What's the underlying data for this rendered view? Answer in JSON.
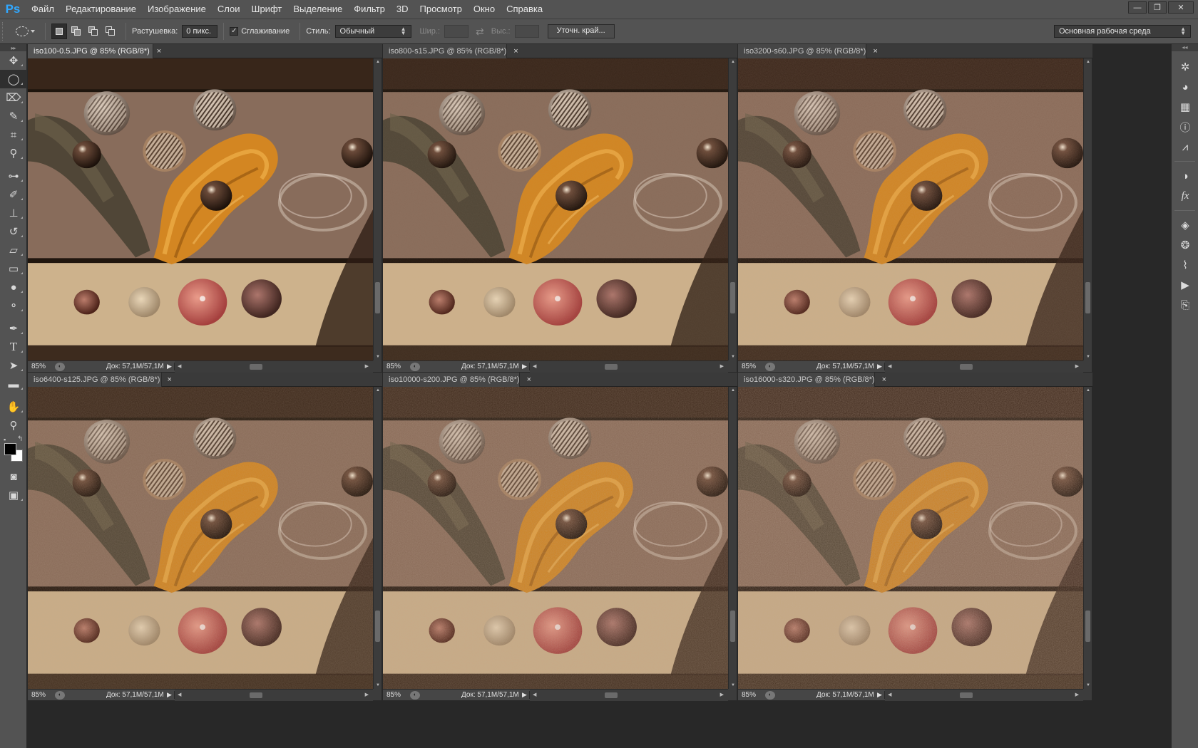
{
  "app": {
    "logo": "Ps"
  },
  "menu": [
    "Файл",
    "Редактирование",
    "Изображение",
    "Слои",
    "Шрифт",
    "Выделение",
    "Фильтр",
    "3D",
    "Просмотр",
    "Окно",
    "Справка"
  ],
  "window_controls": {
    "minimize": "—",
    "restore": "❐",
    "close": "✕"
  },
  "options": {
    "feather_label": "Растушевка:",
    "feather_value": "0 пикс.",
    "antialias_label": "Сглаживание",
    "antialias_checked": true,
    "style_label": "Стиль:",
    "style_value": "Обычный",
    "width_label": "Шир.:",
    "height_label": "Выс.:",
    "refine_button": "Уточн. край...",
    "workspace_value": "Основная рабочая среда"
  },
  "tools": [
    "move-tool",
    "elliptical-marquee-tool",
    "polygonal-lasso-tool",
    "quick-selection-tool",
    "crop-tool",
    "eyedropper-tool",
    "spot-healing-brush-tool",
    "brush-tool",
    "clone-stamp-tool",
    "history-brush-tool",
    "eraser-tool",
    "gradient-tool",
    "blur-tool",
    "dodge-tool",
    "pen-tool",
    "type-tool",
    "path-selection-tool",
    "rectangle-tool",
    "hand-tool",
    "zoom-tool"
  ],
  "active_tool": "elliptical-marquee-tool",
  "colors": {
    "foreground": "#000000",
    "background": "#ffffff",
    "accent": "#31a8ff",
    "chrome": "#535353",
    "workspace": "#282828"
  },
  "right_panels": [
    "navigator-icon",
    "color-icon",
    "swatches-icon",
    "info-icon",
    "histogram-icon",
    "adjustments-icon",
    "styles-icon",
    "layers-icon",
    "channels-icon",
    "paths-icon",
    "actions-icon",
    "history-icon"
  ],
  "documents": [
    {
      "tab": "iso100-0.5.JPG @ 85% (RGB/8*)",
      "zoom": "85%",
      "doc": "Док: 57,1M/57,1M",
      "noise": 0.0,
      "active": true
    },
    {
      "tab": "iso800-s15.JPG @ 85% (RGB/8*)",
      "zoom": "85%",
      "doc": "Док: 57,1M/57,1M",
      "noise": 0.15,
      "active": false
    },
    {
      "tab": "iso3200-s60.JPG @ 85% (RGB/8*)",
      "zoom": "85%",
      "doc": "Док: 57,1M/57,1M",
      "noise": 0.3,
      "active": false
    },
    {
      "tab": "iso6400-s125.JPG @ 85% (RGB/8*)",
      "zoom": "85%",
      "doc": "Док: 57,1M/57,1M",
      "noise": 0.45,
      "active": false
    },
    {
      "tab": "iso10000-s200.JPG @ 85% (RGB/8*)",
      "zoom": "85%",
      "doc": "Док: 57,1M/57,1M",
      "noise": 0.6,
      "active": false
    },
    {
      "tab": "iso16000-s320.JPG @ 85% (RGB/8*)",
      "zoom": "85%",
      "doc": "Док: 57,1M/57,1M",
      "noise": 0.75,
      "active": false
    }
  ]
}
